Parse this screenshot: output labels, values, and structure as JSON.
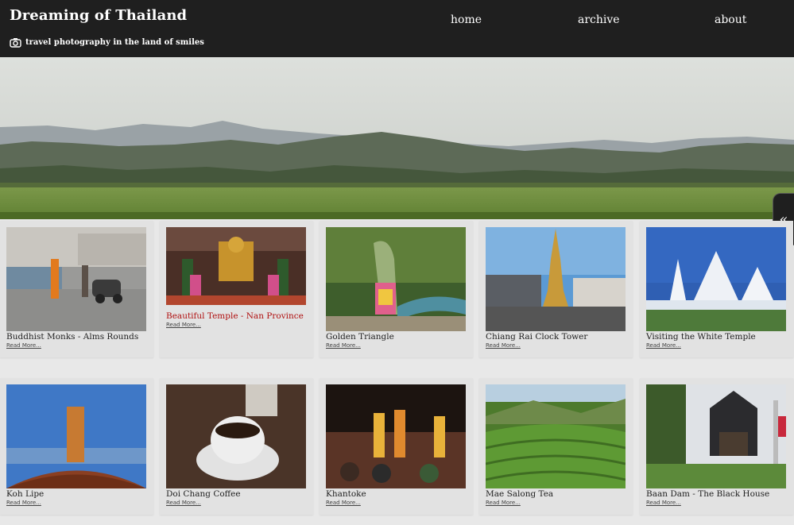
{
  "header": {
    "title": "Dreaming of Thailand",
    "tagline": "travel photography in the land of smiles",
    "nav": [
      "home",
      "archive",
      "about"
    ]
  },
  "side_tab": {
    "glyph": "«"
  },
  "cards": [
    {
      "title": "Buddhist Monks - Alms Rounds",
      "read_more": "Read More..."
    },
    {
      "title": "Beautiful Temple - Nan Province",
      "read_more": "Read More..."
    },
    {
      "title": "Golden Triangle",
      "read_more": "Read More..."
    },
    {
      "title": "Chiang Rai Clock Tower",
      "read_more": "Read More..."
    },
    {
      "title": "Visiting the White Temple",
      "read_more": "Read More..."
    },
    {
      "title": "Koh Lipe",
      "read_more": "Read More..."
    },
    {
      "title": "Doi Chang Coffee",
      "read_more": "Read More..."
    },
    {
      "title": "Khantoke",
      "read_more": "Read More..."
    },
    {
      "title": "Mae Salong Tea",
      "read_more": "Read More..."
    },
    {
      "title": "Baan Dam - The Black House",
      "read_more": "Read More..."
    }
  ],
  "colors": {
    "header_bg": "#1f1f1f",
    "highlight_title": "#b01010",
    "page_bg": "#e8e8e8"
  }
}
